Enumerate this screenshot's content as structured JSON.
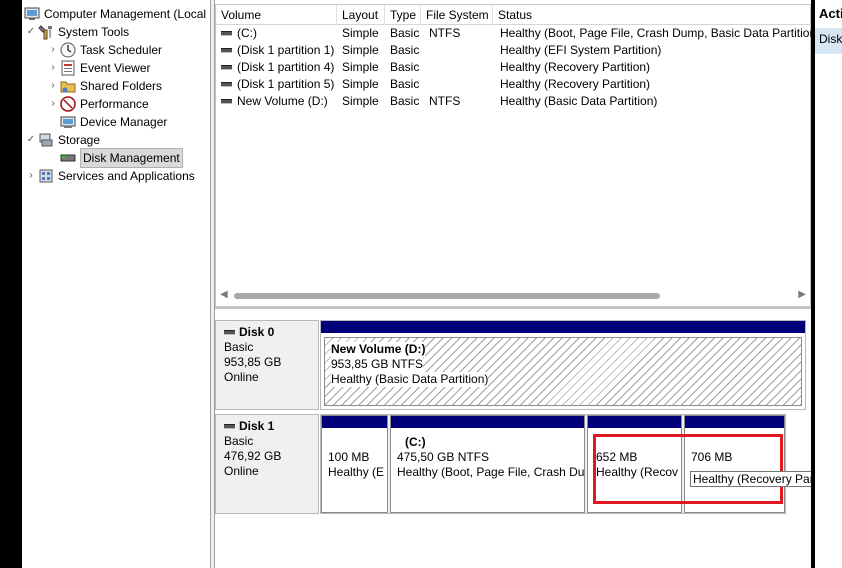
{
  "tree": {
    "root_label": "Computer Management (Local",
    "system_tools": "System Tools",
    "task_scheduler": "Task Scheduler",
    "event_viewer": "Event Viewer",
    "shared_folders": "Shared Folders",
    "performance": "Performance",
    "device_manager": "Device Manager",
    "storage": "Storage",
    "disk_management": "Disk Management",
    "services_apps": "Services and Applications"
  },
  "volume_list": {
    "headers": [
      "Volume",
      "Layout",
      "Type",
      "File System",
      "Status"
    ],
    "rows": [
      {
        "volume": "(C:)",
        "layout": "Simple",
        "type": "Basic",
        "fs": "NTFS",
        "status": "Healthy (Boot, Page File, Crash Dump, Basic Data Partition)"
      },
      {
        "volume": "(Disk 1 partition 1)",
        "layout": "Simple",
        "type": "Basic",
        "fs": "",
        "status": "Healthy (EFI System Partition)"
      },
      {
        "volume": "(Disk 1 partition 4)",
        "layout": "Simple",
        "type": "Basic",
        "fs": "",
        "status": "Healthy (Recovery Partition)"
      },
      {
        "volume": "(Disk 1 partition 5)",
        "layout": "Simple",
        "type": "Basic",
        "fs": "",
        "status": "Healthy (Recovery Partition)"
      },
      {
        "volume": "New Volume (D:)",
        "layout": "Simple",
        "type": "Basic",
        "fs": "NTFS",
        "status": "Healthy (Basic Data Partition)"
      }
    ]
  },
  "disks": {
    "disk0": {
      "name": "Disk 0",
      "type": "Basic",
      "size": "953,85 GB",
      "state": "Online",
      "partitions": [
        {
          "title": "New Volume  (D:)",
          "size": "953,85 GB NTFS",
          "status": "Healthy (Basic Data Partition)"
        }
      ]
    },
    "disk1": {
      "name": "Disk 1",
      "type": "Basic",
      "size": "476,92 GB",
      "state": "Online",
      "partitions": [
        {
          "title": "",
          "size": "100 MB",
          "status": "Healthy (E"
        },
        {
          "title": "(C:)",
          "size": "475,50 GB NTFS",
          "status": "Healthy (Boot, Page File, Crash Du"
        },
        {
          "title": "",
          "size": "652 MB",
          "status": "Healthy (Recov"
        },
        {
          "title": "",
          "size": "706 MB",
          "status": "Healthy (Recovery Partition)"
        }
      ]
    }
  },
  "actions": {
    "title": "Acti",
    "item": "Disk"
  },
  "tooltip": "Healthy (Recovery Partition)",
  "colors": {
    "partition_bar": "#00007b",
    "highlight": "#e2171f"
  }
}
